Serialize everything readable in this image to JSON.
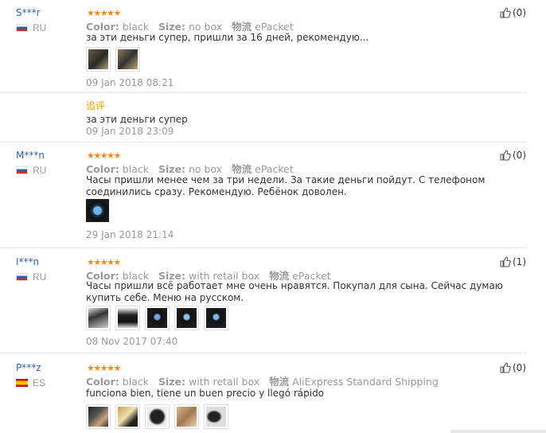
{
  "reviews": [
    {
      "user": "S***r",
      "country": "RU",
      "flag": "ru",
      "rating": 5,
      "stars": "★★★★★",
      "color_label": "Color:",
      "color": "black",
      "size_label": "Size:",
      "size": "no box",
      "shipping_label": "物流",
      "shipping": "ePacket",
      "text": "за эти деньги супер, пришли за 16 дней, рекомендую...",
      "photos": [
        "phone-dark",
        "phone-dark"
      ],
      "date": "09 Jan 2018 08:21",
      "followup_label": "追评",
      "followup_text": "за эти деньги супер",
      "followup_date": "09 Jan 2018 23:09",
      "likes": "(0)"
    },
    {
      "user": "M***n",
      "country": "RU",
      "flag": "ru",
      "rating": 5,
      "stars": "★★★★★",
      "color_label": "Color:",
      "color": "black",
      "size_label": "Size:",
      "size": "no box",
      "shipping_label": "物流",
      "shipping": "ePacket",
      "text": "Часы пришли менее чем за три недели. За такие деньги пойдут. С телефоном соединились сразу. Рекомендую. Ребёнок доволен.",
      "photos": [
        "watch-blue"
      ],
      "date": "29 Jan 2018 21:14",
      "likes": "(0)"
    },
    {
      "user": "I***n",
      "country": "RU",
      "flag": "ru",
      "rating": 5,
      "stars": "★★★★★",
      "color_label": "Color:",
      "color": "black",
      "size_label": "Size:",
      "size": "with retail box",
      "shipping_label": "物流",
      "shipping": "ePacket",
      "text": "Часы пришли всё работает мне очень нравятся. Покупал для сына. Сейчас думаю купить себе. Меню на русском.",
      "photos": [
        "watch-dark",
        "watch-dark",
        "watch-blue",
        "watch-blue",
        "watch-blue"
      ],
      "date": "08 Nov 2017 07:40",
      "likes": "(1)"
    },
    {
      "user": "P***z",
      "country": "ES",
      "flag": "es",
      "rating": 5,
      "stars": "★★★★★",
      "color_label": "Color:",
      "color": "black",
      "size_label": "Size:",
      "size": "with retail box",
      "shipping_label": "物流",
      "shipping": "AliExpress Standard Shipping",
      "text": "funciona bien, tiene un buen precio y llegó rápido",
      "photos": [
        "watch-hand",
        "box-gold",
        "watch-dark",
        "box-gold",
        "watch-dark"
      ],
      "likes": "(0)"
    }
  ],
  "colors": {
    "link": "#3366aa",
    "stars": "#f08a1c",
    "muted": "#999999",
    "followup": "#e8a000"
  }
}
